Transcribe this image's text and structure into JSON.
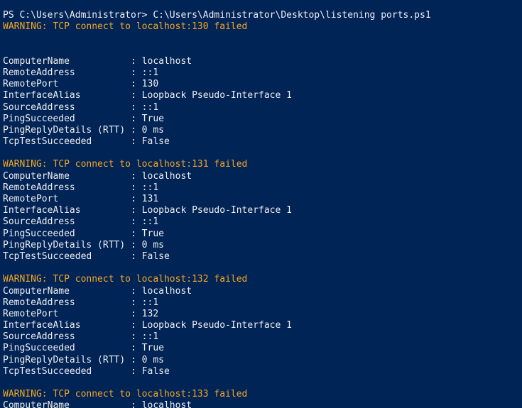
{
  "console": {
    "prompt_line": "PS C:\\Users\\Administrator> C:\\Users\\Administrator\\Desktop\\listening ports.ps1",
    "warnings": [
      "WARNING: TCP connect to localhost:130 failed",
      "WARNING: TCP connect to localhost:131 failed",
      "WARNING: TCP connect to localhost:132 failed",
      "WARNING: TCP connect to localhost:133 failed"
    ],
    "results": [
      {
        "computer_name": "ComputerName           : localhost",
        "remote_address": "RemoteAddress          : ::1",
        "remote_port": "RemotePort             : 130",
        "interface_alias": "InterfaceAlias         : Loopback Pseudo-Interface 1",
        "source_address": "SourceAddress          : ::1",
        "ping_succeeded": "PingSucceeded          : True",
        "ping_reply": "PingReplyDetails (RTT) : 0 ms",
        "tcp_test": "TcpTestSucceeded       : False"
      },
      {
        "computer_name": "ComputerName           : localhost",
        "remote_address": "RemoteAddress          : ::1",
        "remote_port": "RemotePort             : 131",
        "interface_alias": "InterfaceAlias         : Loopback Pseudo-Interface 1",
        "source_address": "SourceAddress          : ::1",
        "ping_succeeded": "PingSucceeded          : True",
        "ping_reply": "PingReplyDetails (RTT) : 0 ms",
        "tcp_test": "TcpTestSucceeded       : False"
      },
      {
        "computer_name": "ComputerName           : localhost",
        "remote_address": "RemoteAddress          : ::1",
        "remote_port": "RemotePort             : 132",
        "interface_alias": "InterfaceAlias         : Loopback Pseudo-Interface 1",
        "source_address": "SourceAddress          : ::1",
        "ping_succeeded": "PingSucceeded          : True",
        "ping_reply": "PingReplyDetails (RTT) : 0 ms",
        "tcp_test": "TcpTestSucceeded       : False"
      },
      {
        "computer_name": "ComputerName           : localhost"
      }
    ],
    "colors": {
      "background": "#012456",
      "foreground": "#eeedf0",
      "warning": "#f5a623"
    }
  }
}
